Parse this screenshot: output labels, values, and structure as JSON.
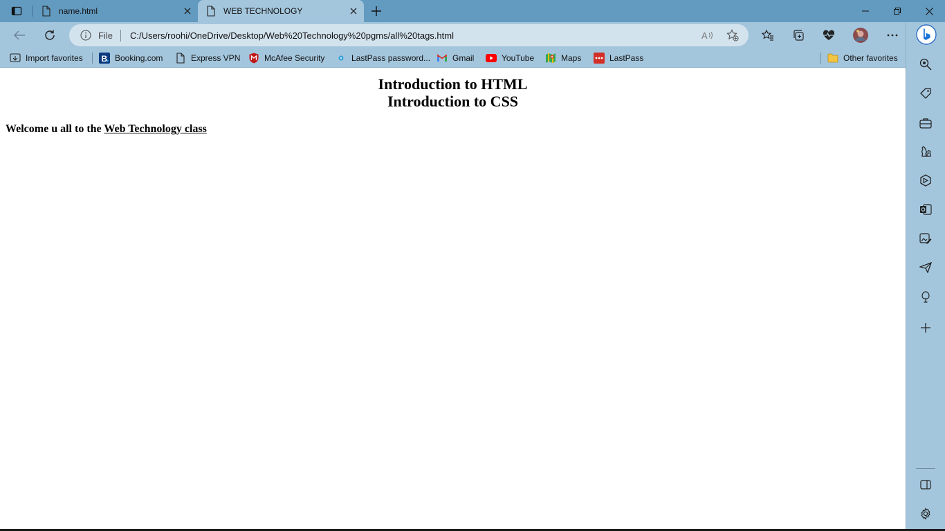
{
  "browser": {
    "tabs": [
      {
        "title": "name.html",
        "active": false
      },
      {
        "title": "WEB TECHNOLOGY",
        "active": true
      }
    ],
    "address_bar": {
      "scheme_label": "File",
      "url": "C:/Users/roohi/OneDrive/Desktop/Web%20Technology%20pgms/all%20tags.html"
    },
    "favorites": [
      {
        "label": "Import favorites",
        "icon": "import-favorites-icon"
      },
      {
        "label": "Booking.com",
        "icon": "booking-icon"
      },
      {
        "label": "Express VPN",
        "icon": "page-icon"
      },
      {
        "label": "McAfee Security",
        "icon": "mcafee-icon"
      },
      {
        "label": "LastPass password...",
        "icon": "lastpass-dot-icon"
      },
      {
        "label": "Gmail",
        "icon": "gmail-icon"
      },
      {
        "label": "YouTube",
        "icon": "youtube-icon"
      },
      {
        "label": "Maps",
        "icon": "maps-icon"
      },
      {
        "label": "LastPass",
        "icon": "lastpass-icon"
      }
    ],
    "other_favorites": "Other favorites",
    "colors": {
      "tabstrip": "#639ac0",
      "toolbar": "#a4c6dd",
      "address_bar": "#d3e3ee"
    }
  },
  "page": {
    "headings": [
      "Introduction to HTML",
      "Introduction to CSS"
    ],
    "welcome_prefix": "Welcome u all to the ",
    "welcome_link": "Web Technology class"
  }
}
